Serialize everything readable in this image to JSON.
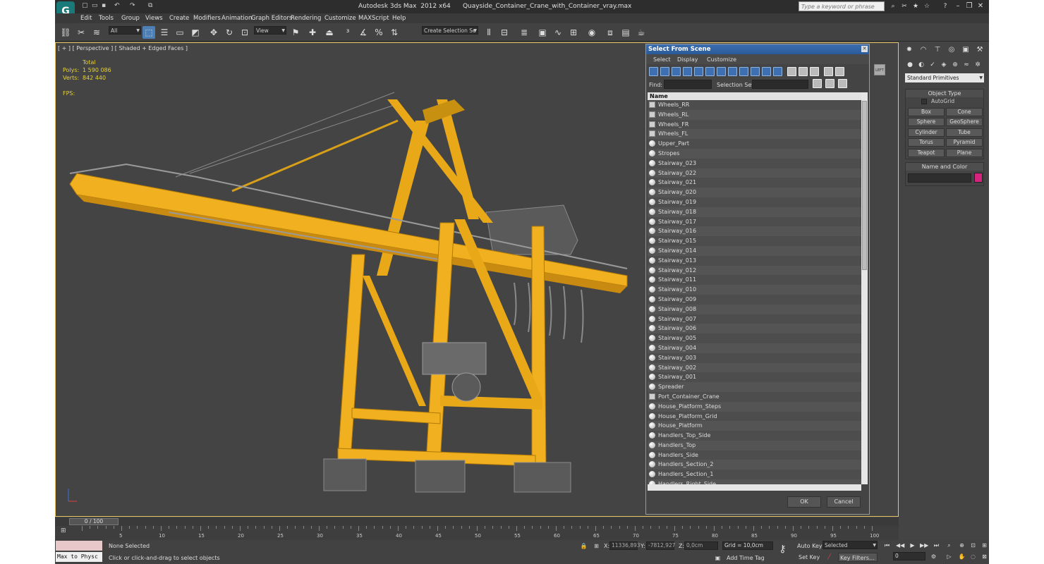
{
  "window": {
    "app_title": "Autodesk 3ds Max  2012 x64",
    "file_title": "Quayside_Container_Crane_with_Container_vray.max",
    "search_placeholder": "Type a keyword or phrase"
  },
  "menu": [
    "Edit",
    "Tools",
    "Group",
    "Views",
    "Create",
    "Modifiers",
    "Animation",
    "Graph Editors",
    "Rendering",
    "Customize",
    "MAXScript",
    "Help"
  ],
  "toolbar": {
    "filter_select": "All",
    "ref_coord_select": "View",
    "selection_set_select": "Create Selection Se"
  },
  "viewport": {
    "label": "[ + ] [ Perspective ] [ Shaded + Edged Faces ]",
    "stats_total": "Total",
    "polys_label": "Polys:",
    "polys_value": "1 590 086",
    "verts_label": "Verts:",
    "verts_value": "842 440",
    "fps_label": "FPS:"
  },
  "dialog": {
    "title": "Select From Scene",
    "menu": [
      "Select",
      "Display",
      "Customize"
    ],
    "find_label": "Find:",
    "selection_set_label": "Selection Set:",
    "column_header": "Name",
    "items": [
      {
        "name": "Wheels_RR",
        "icon": "group"
      },
      {
        "name": "Wheels_RL",
        "icon": "group"
      },
      {
        "name": "Wheels_FR",
        "icon": "group"
      },
      {
        "name": "Wheels_FL",
        "icon": "group"
      },
      {
        "name": "Upper_Part",
        "icon": "sphere"
      },
      {
        "name": "Stropes",
        "icon": "sphere"
      },
      {
        "name": "Stairway_023",
        "icon": "sphere"
      },
      {
        "name": "Stairway_022",
        "icon": "sphere"
      },
      {
        "name": "Stairway_021",
        "icon": "sphere"
      },
      {
        "name": "Stairway_020",
        "icon": "sphere"
      },
      {
        "name": "Stairway_019",
        "icon": "sphere"
      },
      {
        "name": "Stairway_018",
        "icon": "sphere"
      },
      {
        "name": "Stairway_017",
        "icon": "sphere"
      },
      {
        "name": "Stairway_016",
        "icon": "sphere"
      },
      {
        "name": "Stairway_015",
        "icon": "sphere"
      },
      {
        "name": "Stairway_014",
        "icon": "sphere"
      },
      {
        "name": "Stairway_013",
        "icon": "sphere"
      },
      {
        "name": "Stairway_012",
        "icon": "sphere"
      },
      {
        "name": "Stairway_011",
        "icon": "sphere"
      },
      {
        "name": "Stairway_010",
        "icon": "sphere"
      },
      {
        "name": "Stairway_009",
        "icon": "sphere"
      },
      {
        "name": "Stairway_008",
        "icon": "sphere"
      },
      {
        "name": "Stairway_007",
        "icon": "sphere"
      },
      {
        "name": "Stairway_006",
        "icon": "sphere"
      },
      {
        "name": "Stairway_005",
        "icon": "sphere"
      },
      {
        "name": "Stairway_004",
        "icon": "sphere"
      },
      {
        "name": "Stairway_003",
        "icon": "sphere"
      },
      {
        "name": "Stairway_002",
        "icon": "sphere"
      },
      {
        "name": "Stairway_001",
        "icon": "sphere"
      },
      {
        "name": "Spreader",
        "icon": "sphere"
      },
      {
        "name": "Port_Container_Crane",
        "icon": "group"
      },
      {
        "name": "House_Platform_Steps",
        "icon": "sphere"
      },
      {
        "name": "House_Platform_Grid",
        "icon": "sphere"
      },
      {
        "name": "House_Platform",
        "icon": "sphere"
      },
      {
        "name": "Handlers_Top_Side",
        "icon": "sphere"
      },
      {
        "name": "Handlers_Top",
        "icon": "sphere"
      },
      {
        "name": "Handlers_Side",
        "icon": "sphere"
      },
      {
        "name": "Handlers_Section_2",
        "icon": "sphere"
      },
      {
        "name": "Handlers_Section_1",
        "icon": "sphere"
      },
      {
        "name": "Handlers_Right_Side",
        "icon": "sphere"
      }
    ],
    "ok_label": "OK",
    "cancel_label": "Cancel"
  },
  "command_panel": {
    "category_select": "Standard Primitives",
    "object_type_title": "Object Type",
    "autogrid_label": "AutoGrid",
    "buttons": [
      "Box",
      "Cone",
      "Sphere",
      "GeoSphere",
      "Cylinder",
      "Tube",
      "Torus",
      "Pyramid",
      "Teapot",
      "Plane"
    ],
    "name_color_title": "Name and Color",
    "object_color": "#d4247d"
  },
  "timeline": {
    "frame_display": "0 / 100",
    "ticks": [
      "5",
      "10",
      "15",
      "20",
      "25",
      "30",
      "35",
      "40",
      "45",
      "50",
      "55",
      "60",
      "65",
      "70",
      "75",
      "80",
      "85",
      "90",
      "95",
      "100"
    ]
  },
  "status": {
    "script_listener": "Max to Physc",
    "selection_status": "None Selected",
    "prompt": "Click or click-and-drag to select objects",
    "x_label": "X:",
    "x_value": "11336,893",
    "y_label": "Y:",
    "y_value": "-7812,927",
    "z_label": "Z:",
    "z_value": "0,0cm",
    "grid": "Grid = 10,0cm",
    "add_time_tag": "Add Time Tag",
    "auto_key": "Auto Key",
    "set_key": "Set Key",
    "key_mode_select": "Selected",
    "key_filters": "Key Filters...",
    "current_frame": "0"
  },
  "colors": {
    "crane_yellow": "#f0b020",
    "viewport_bg": "#444444",
    "active_viewport_border": "#e8c468",
    "stats_text": "#e5d03a",
    "dialog_title": "#2a5a99"
  }
}
